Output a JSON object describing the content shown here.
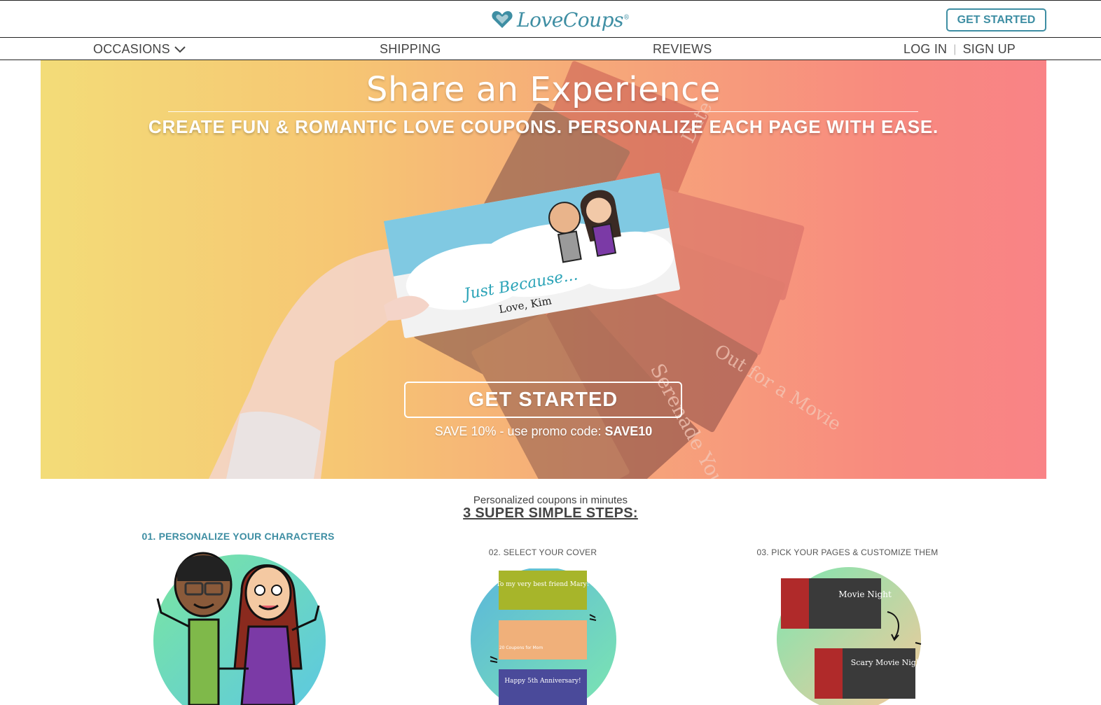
{
  "header": {
    "logo_text": "LoveCoups",
    "logo_mark": "®",
    "get_started_label": "GET STARTED"
  },
  "nav": {
    "occasions_label": "OCCASIONS",
    "shipping_label": "SHIPPING",
    "reviews_label": "REVIEWS",
    "login_label": "LOG IN",
    "separator": "|",
    "signup_label": "SIGN UP"
  },
  "hero": {
    "title": "Share an Experience",
    "subtitle": "CREATE FUN & ROMANTIC LOVE COUPONS. PERSONALIZE EACH PAGE WITH EASE.",
    "button_label": "GET STARTED",
    "promo_prefix": "SAVE 10% - use promo code: ",
    "promo_code": "SAVE10",
    "card_text_main": "Just Because...",
    "card_text_sign": "Love, Kim",
    "back_cards": [
      "Out for a Movie",
      "Serenade You...",
      "Date"
    ]
  },
  "steps": {
    "intro": "Personalized coupons in minutes",
    "title": "3 SUPER SIMPLE STEPS:",
    "step1": "01. PERSONALIZE YOUR CHARACTERS",
    "step2": "02. SELECT YOUR COVER",
    "step3": "03. PICK YOUR PAGES & CUSTOMIZE THEM",
    "covers": [
      "To my very best friend Mary!",
      "20 Coupons for Mom",
      "Happy 5th Anniversary!"
    ],
    "pages": [
      "Movie Night",
      "Scary Movie Night"
    ]
  },
  "colors": {
    "brand_teal": "#3e8ea3",
    "hero_left": "#f3dc78",
    "hero_right": "#f98386"
  }
}
